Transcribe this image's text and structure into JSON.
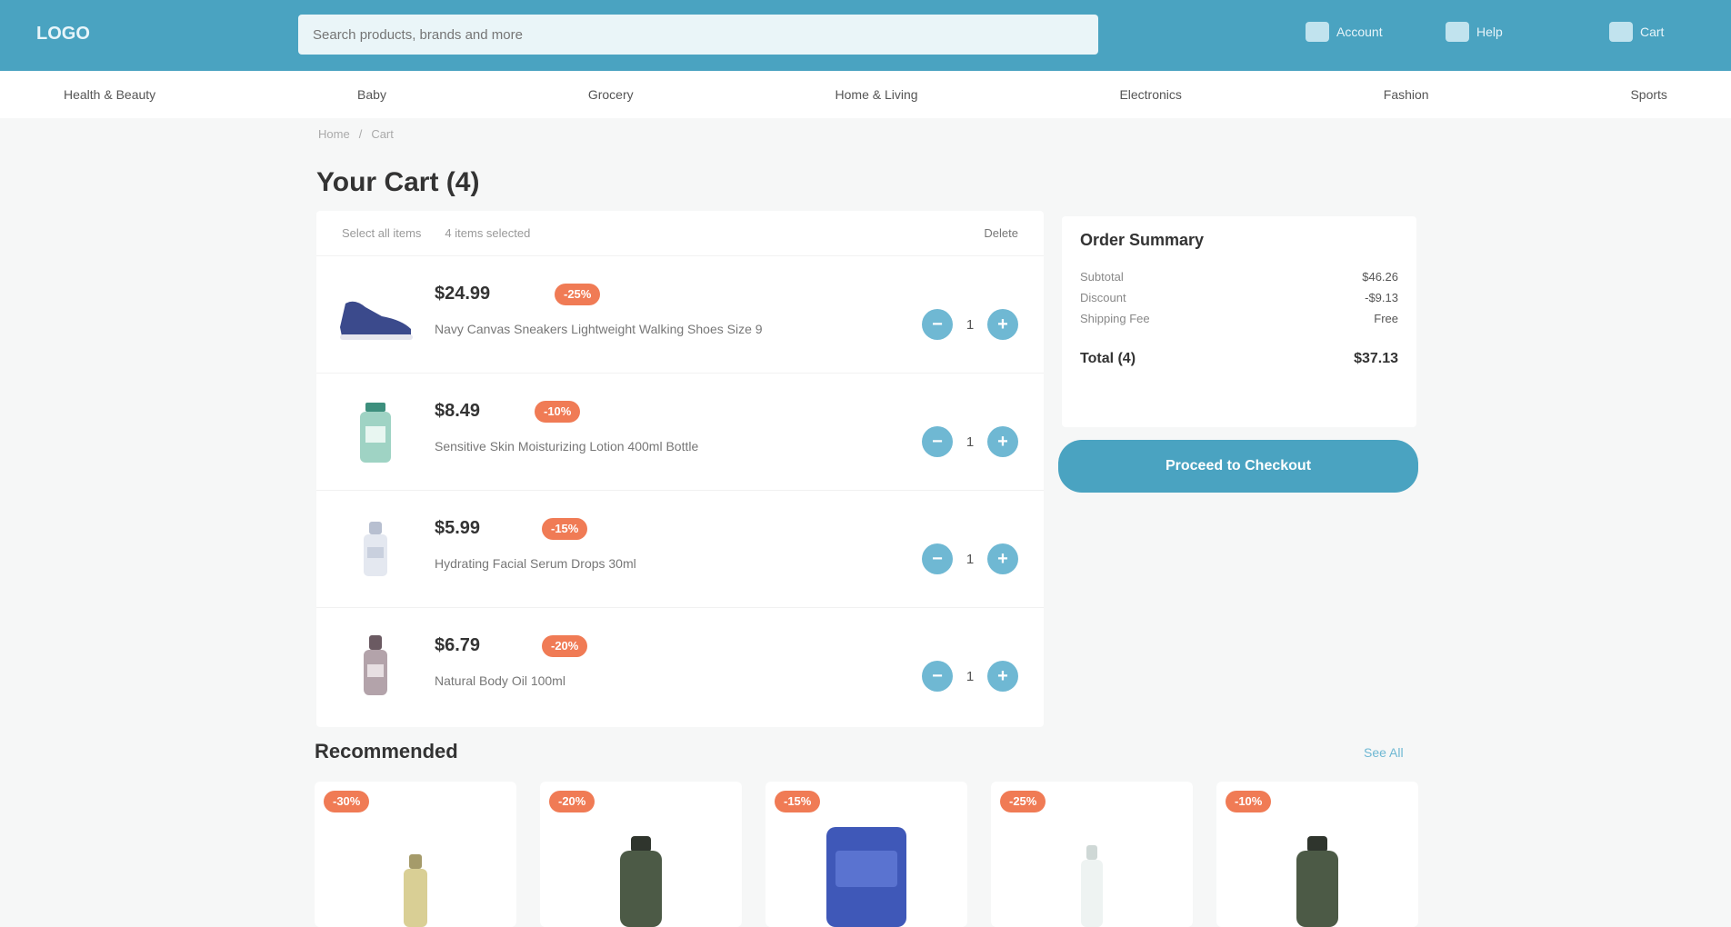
{
  "header": {
    "logo": "LOGO",
    "search_placeholder": "Search products, brands and more",
    "actions": [
      {
        "label": "Account",
        "icon": "user-icon"
      },
      {
        "label": "Help",
        "icon": "help-icon"
      },
      {
        "label": "Cart",
        "icon": "cart-icon"
      }
    ]
  },
  "categories": [
    "Health & Beauty",
    "Baby",
    "Grocery",
    "Home & Living",
    "Electronics",
    "Fashion",
    "Sports"
  ],
  "breadcrumb": [
    "Home",
    "Cart"
  ],
  "page_title": "Your Cart (4)",
  "cart": {
    "select_all_label": "Select all items",
    "selected_label": "4 items selected",
    "delete_label": "Delete",
    "items": [
      {
        "price": "$24.99",
        "badge": "-25%",
        "name": "Navy Canvas Sneakers Lightweight Walking Shoes Size 9",
        "qty": "1",
        "image": "shoe-image"
      },
      {
        "price": "$8.49",
        "badge": "-10%",
        "name": "Sensitive Skin Moisturizing Lotion 400ml Bottle",
        "qty": "1",
        "image": "lotion-image"
      },
      {
        "price": "$5.99",
        "badge": "-15%",
        "name": "Hydrating Facial Serum Drops 30ml",
        "qty": "1",
        "image": "serum-image"
      },
      {
        "price": "$6.79",
        "badge": "-20%",
        "name": "Natural Body Oil 100ml",
        "qty": "1",
        "image": "oil-image"
      }
    ]
  },
  "summary": {
    "title": "Order Summary",
    "rows": [
      {
        "label": "Subtotal",
        "value": "$46.26"
      },
      {
        "label": "Discount",
        "value": "-$9.13"
      },
      {
        "label": "Shipping Fee",
        "value": "Free"
      }
    ],
    "total_label": "Total (4)",
    "total_value": "$37.13",
    "checkout_label": "Proceed to Checkout"
  },
  "recommended": {
    "title": "Recommended",
    "see_all": "See All",
    "items": [
      {
        "badge": "-30%",
        "image": "bottle-image"
      },
      {
        "badge": "-20%",
        "image": "bottle-image"
      },
      {
        "badge": "-15%",
        "image": "box-image"
      },
      {
        "badge": "-25%",
        "image": "bottle-image"
      },
      {
        "badge": "-10%",
        "image": "bottle-image"
      }
    ]
  },
  "colors": {
    "brand": "#4aa3c1",
    "discount": "#f07b55",
    "qty_button": "#6fb8d3"
  }
}
